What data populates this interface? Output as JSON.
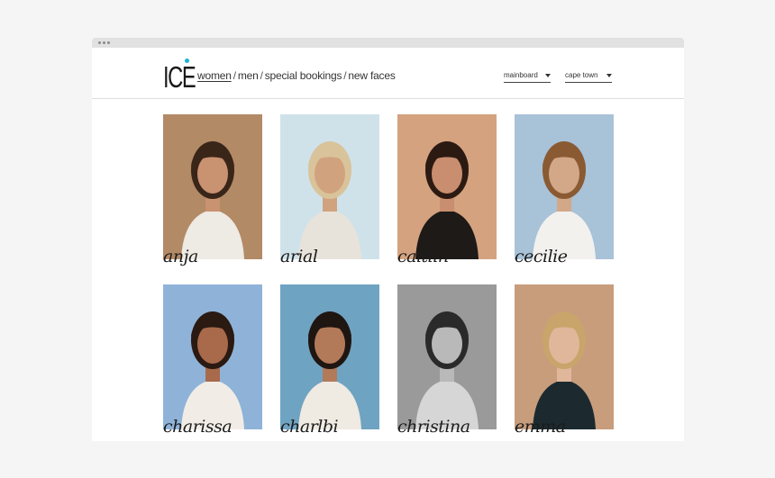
{
  "logo": {
    "text": "ICE",
    "accent_color": "#1bb3d6"
  },
  "nav": {
    "items": [
      {
        "label": "women",
        "active": true
      },
      {
        "label": "men",
        "active": false
      },
      {
        "label": "special bookings",
        "active": false
      },
      {
        "label": "new faces",
        "active": false
      }
    ],
    "separator": "/"
  },
  "filters": {
    "board": {
      "value": "mainboard"
    },
    "city": {
      "value": "cape town"
    }
  },
  "models": [
    {
      "name": "anja",
      "bg": "#b38a66",
      "skin": "#c99270",
      "hair": "#3a2519",
      "top": "#eeeae4"
    },
    {
      "name": "arial",
      "bg": "#cfe2ea",
      "skin": "#d1a27e",
      "hair": "#d9c39b",
      "top": "#e8e3da"
    },
    {
      "name": "caitlin",
      "bg": "#d4a27f",
      "skin": "#c98e6f",
      "hair": "#2b1a12",
      "top": "#1e1a18"
    },
    {
      "name": "cecilie",
      "bg": "#a8c2d8",
      "skin": "#d2a889",
      "hair": "#8a5a33",
      "top": "#f3f1ee"
    },
    {
      "name": "charissa",
      "bg": "#8fb3d8",
      "skin": "#a86a4b",
      "hair": "#2a1a12",
      "top": "#f1ede6"
    },
    {
      "name": "charlbi",
      "bg": "#6fa3c2",
      "skin": "#b37a5a",
      "hair": "#1f1612",
      "top": "#efeae2"
    },
    {
      "name": "christina",
      "bg": "#9a9a9a",
      "skin": "#b9b9b9",
      "hair": "#2a2a2a",
      "top": "#d6d6d6"
    },
    {
      "name": "emma",
      "bg": "#c79d7c",
      "skin": "#e0b79a",
      "hair": "#c9a46b",
      "top": "#1c2a30"
    }
  ]
}
